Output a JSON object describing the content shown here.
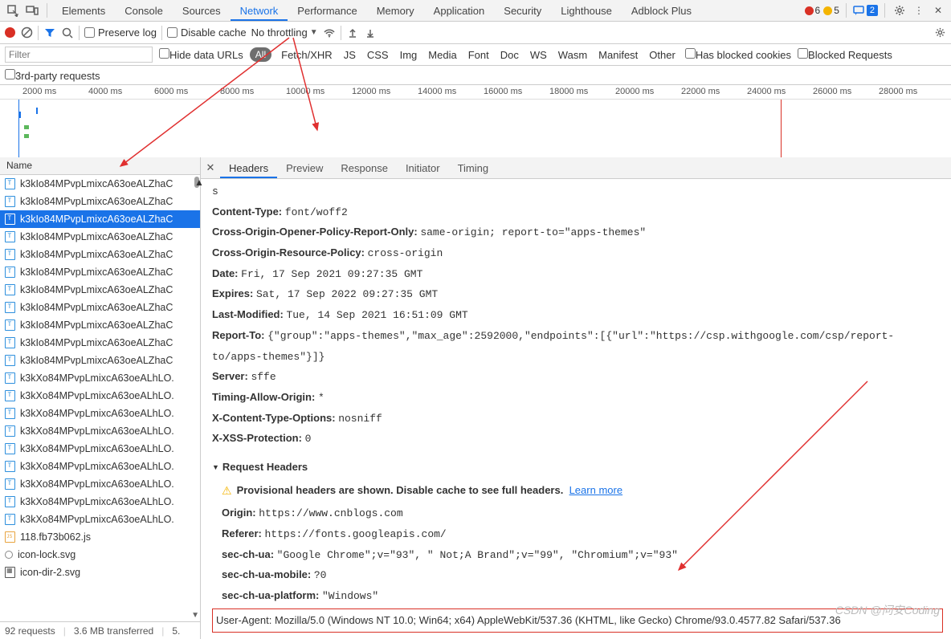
{
  "tabs": [
    "Elements",
    "Console",
    "Sources",
    "Network",
    "Performance",
    "Memory",
    "Application",
    "Security",
    "Lighthouse",
    "Adblock Plus"
  ],
  "activeTab": "Network",
  "errors": {
    "red": "6",
    "yellow": "5"
  },
  "messages": "2",
  "toolbar": {
    "preserve_log": "Preserve log",
    "disable_cache": "Disable cache",
    "throttling": "No throttling"
  },
  "filter": {
    "placeholder": "Filter",
    "hide_data_urls": "Hide data URLs",
    "all": "All",
    "types": [
      "Fetch/XHR",
      "JS",
      "CSS",
      "Img",
      "Media",
      "Font",
      "Doc",
      "WS",
      "Wasm",
      "Manifest",
      "Other"
    ],
    "has_blocked": "Has blocked cookies",
    "blocked_req": "Blocked Requests",
    "third_party": "3rd-party requests"
  },
  "timeline_ticks": [
    "2000 ms",
    "4000 ms",
    "6000 ms",
    "8000 ms",
    "10000 ms",
    "12000 ms",
    "14000 ms",
    "16000 ms",
    "18000 ms",
    "20000 ms",
    "22000 ms",
    "24000 ms",
    "26000 ms",
    "28000 ms"
  ],
  "left": {
    "header": "Name",
    "status": {
      "requests": "92 requests",
      "transferred": "3.6 MB transferred",
      "more": "5."
    },
    "items": [
      {
        "name": "k3kIo84MPvpLmixcA63oeALZhaC",
        "t": "f"
      },
      {
        "name": "k3kIo84MPvpLmixcA63oeALZhaC",
        "t": "f"
      },
      {
        "name": "k3kIo84MPvpLmixcA63oeALZhaC",
        "t": "f",
        "sel": true
      },
      {
        "name": "k3kIo84MPvpLmixcA63oeALZhaC",
        "t": "f"
      },
      {
        "name": "k3kIo84MPvpLmixcA63oeALZhaC",
        "t": "f"
      },
      {
        "name": "k3kIo84MPvpLmixcA63oeALZhaC",
        "t": "f"
      },
      {
        "name": "k3kIo84MPvpLmixcA63oeALZhaC",
        "t": "f"
      },
      {
        "name": "k3kIo84MPvpLmixcA63oeALZhaC",
        "t": "f"
      },
      {
        "name": "k3kIo84MPvpLmixcA63oeALZhaC",
        "t": "f"
      },
      {
        "name": "k3kIo84MPvpLmixcA63oeALZhaC",
        "t": "f"
      },
      {
        "name": "k3kIo84MPvpLmixcA63oeALZhaC",
        "t": "f"
      },
      {
        "name": "k3kXo84MPvpLmixcA63oeALhLO.",
        "t": "f"
      },
      {
        "name": "k3kXo84MPvpLmixcA63oeALhLO.",
        "t": "f"
      },
      {
        "name": "k3kXo84MPvpLmixcA63oeALhLO.",
        "t": "f"
      },
      {
        "name": "k3kXo84MPvpLmixcA63oeALhLO.",
        "t": "f"
      },
      {
        "name": "k3kXo84MPvpLmixcA63oeALhLO.",
        "t": "f"
      },
      {
        "name": "k3kXo84MPvpLmixcA63oeALhLO.",
        "t": "f"
      },
      {
        "name": "k3kXo84MPvpLmixcA63oeALhLO.",
        "t": "f"
      },
      {
        "name": "k3kXo84MPvpLmixcA63oeALhLO.",
        "t": "f"
      },
      {
        "name": "k3kXo84MPvpLmixcA63oeALhLO.",
        "t": "f"
      },
      {
        "name": "118.fb73b062.js",
        "t": "js"
      },
      {
        "name": "icon-lock.svg",
        "t": "svg"
      },
      {
        "name": "icon-dir-2.svg",
        "t": "grid"
      }
    ]
  },
  "right": {
    "tabs": [
      "Headers",
      "Preview",
      "Response",
      "Initiator",
      "Timing"
    ],
    "activeTab": "Headers",
    "s": "s",
    "response_headers": [
      {
        "k": "Content-Type:",
        "v": "font/woff2"
      },
      {
        "k": "Cross-Origin-Opener-Policy-Report-Only:",
        "v": "same-origin; report-to=\"apps-themes\""
      },
      {
        "k": "Cross-Origin-Resource-Policy:",
        "v": "cross-origin"
      },
      {
        "k": "Date:",
        "v": "Fri, 17 Sep 2021 09:27:35 GMT"
      },
      {
        "k": "Expires:",
        "v": "Sat, 17 Sep 2022 09:27:35 GMT"
      },
      {
        "k": "Last-Modified:",
        "v": "Tue, 14 Sep 2021 16:51:09 GMT"
      },
      {
        "k": "Report-To:",
        "v": "{\"group\":\"apps-themes\",\"max_age\":2592000,\"endpoints\":[{\"url\":\"https://csp.withgoogle.com/csp/report-to/apps-themes\"}]}"
      },
      {
        "k": "Server:",
        "v": "sffe"
      },
      {
        "k": "Timing-Allow-Origin:",
        "v": "*"
      },
      {
        "k": "X-Content-Type-Options:",
        "v": "nosniff"
      },
      {
        "k": "X-XSS-Protection:",
        "v": "0"
      }
    ],
    "req_section": "Request Headers",
    "provisional": "Provisional headers are shown. Disable cache to see full headers.",
    "learn_more": "Learn more",
    "request_headers": [
      {
        "k": "Origin:",
        "v": "https://www.cnblogs.com"
      },
      {
        "k": "Referer:",
        "v": "https://fonts.googleapis.com/"
      },
      {
        "k": "sec-ch-ua:",
        "v": "\"Google Chrome\";v=\"93\", \" Not;A Brand\";v=\"99\", \"Chromium\";v=\"93\""
      },
      {
        "k": "sec-ch-ua-mobile:",
        "v": "?0"
      },
      {
        "k": "sec-ch-ua-platform:",
        "v": "\"Windows\""
      }
    ],
    "ua_k": "User-Agent:",
    "ua_v": "Mozilla/5.0 (Windows NT 10.0; Win64; x64) AppleWebKit/537.36 (KHTML, like Gecko) Chrome/93.0.4577.82 Safari/537.36"
  },
  "watermark": "CSDN @问安Coding"
}
